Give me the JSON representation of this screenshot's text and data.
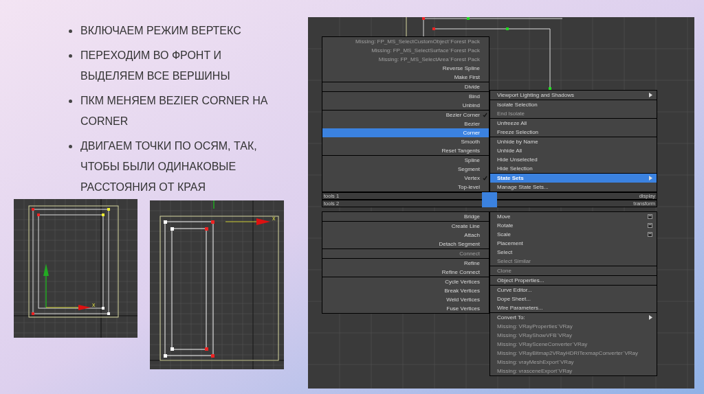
{
  "bullets": [
    "ВКЛЮЧАЕМ РЕЖИМ ВЕРТЕКС",
    "ПЕРЕХОДИМ ВО ФРОНТ И ВЫДЕЛЯЕМ ВСЕ ВЕРШИНЫ",
    "ПКМ МЕНЯЕМ BEZIER CORNER НА CORNER",
    "ДВИГАЕМ ТОЧКИ ПО ОСЯМ, ТАК, ЧТОБЫ БЫЛИ ОДИНАКОВЫЕ РАССТОЯНИЯ ОТ КРАЯ"
  ],
  "viewports": [
    {
      "axis_label": "x"
    },
    {
      "axis_label": "x"
    }
  ],
  "quad_menu": {
    "top_left": [
      [
        {
          "label": "Missing: FP_MS_SelectCustomObject`Forest Pack",
          "disabled": true,
          "checked": false,
          "selected": false
        },
        {
          "label": "Missing: FP_MS_SelectSurface`Forest Pack",
          "disabled": true,
          "checked": false,
          "selected": false
        },
        {
          "label": "Missing: FP_MS_SelectArea`Forest Pack",
          "disabled": true,
          "checked": false,
          "selected": false
        },
        {
          "label": "Reverse Spline",
          "disabled": false,
          "checked": false,
          "selected": false
        },
        {
          "label": "Make First",
          "disabled": false,
          "checked": false,
          "selected": false
        }
      ],
      [
        {
          "label": "Divide",
          "disabled": false,
          "checked": false,
          "selected": false
        }
      ],
      [
        {
          "label": "Bind",
          "disabled": false,
          "checked": false,
          "selected": false
        },
        {
          "label": "Unbind",
          "disabled": false,
          "checked": false,
          "selected": false
        }
      ],
      [
        {
          "label": "Bezier Corner",
          "disabled": false,
          "checked": true,
          "selected": false
        },
        {
          "label": "Bezier",
          "disabled": false,
          "checked": false,
          "selected": false
        },
        {
          "label": "Corner",
          "disabled": false,
          "checked": false,
          "selected": true
        },
        {
          "label": "Smooth",
          "disabled": false,
          "checked": false,
          "selected": false
        },
        {
          "label": "Reset Tangents",
          "disabled": false,
          "checked": false,
          "selected": false
        }
      ],
      [
        {
          "label": "Spline",
          "disabled": false,
          "checked": false,
          "selected": false
        },
        {
          "label": "Segment",
          "disabled": false,
          "checked": false,
          "selected": false
        },
        {
          "label": "Vertex",
          "disabled": false,
          "checked": true,
          "selected": false
        },
        {
          "label": "Top-level",
          "disabled": false,
          "checked": false,
          "selected": false
        }
      ]
    ],
    "top_right": [
      [
        {
          "label": "Viewport Lighting and Shadows",
          "kind": "submenu",
          "disabled": false,
          "selected": false
        }
      ],
      [
        {
          "label": "Isolate Selection",
          "kind": "plain",
          "disabled": false,
          "selected": false
        },
        {
          "label": "End Isolate",
          "kind": "plain",
          "disabled": true,
          "selected": false
        }
      ],
      [
        {
          "label": "Unfreeze All",
          "kind": "plain",
          "disabled": false,
          "selected": false
        },
        {
          "label": "Freeze Selection",
          "kind": "plain",
          "disabled": false,
          "selected": false
        }
      ],
      [
        {
          "label": "Unhide by Name",
          "kind": "plain",
          "disabled": false,
          "selected": false
        },
        {
          "label": "Unhide All",
          "kind": "plain",
          "disabled": false,
          "selected": false
        },
        {
          "label": "Hide Unselected",
          "kind": "plain",
          "disabled": false,
          "selected": false
        },
        {
          "label": "Hide Selection",
          "kind": "plain",
          "disabled": false,
          "selected": false
        }
      ],
      [
        {
          "label": "State Sets",
          "kind": "submenu",
          "disabled": false,
          "selected": true
        },
        {
          "label": "Manage State Sets...",
          "kind": "plain",
          "disabled": false,
          "selected": false
        }
      ]
    ],
    "headers": [
      {
        "left": "tools 1",
        "right": "display"
      },
      {
        "left": "tools 2",
        "right": "transform"
      }
    ],
    "bottom_left": [
      [
        {
          "label": "Bridge",
          "disabled": false,
          "checked": false,
          "selected": false
        }
      ],
      [
        {
          "label": "Create Line",
          "disabled": false,
          "checked": false,
          "selected": false
        },
        {
          "label": "Attach",
          "disabled": false,
          "checked": false,
          "selected": false
        },
        {
          "label": "Detach Segment",
          "disabled": false,
          "checked": false,
          "selected": false
        }
      ],
      [
        {
          "label": "Connect",
          "disabled": true,
          "checked": false,
          "selected": false
        }
      ],
      [
        {
          "label": "Refine",
          "disabled": false,
          "checked": false,
          "selected": false
        },
        {
          "label": "Refine Connect",
          "disabled": false,
          "checked": false,
          "selected": false
        }
      ],
      [
        {
          "label": "Cycle Vertices",
          "disabled": false,
          "checked": false,
          "selected": false
        },
        {
          "label": "Break Vertices",
          "disabled": false,
          "checked": false,
          "selected": false
        },
        {
          "label": "Weld Vertices",
          "disabled": false,
          "checked": false,
          "selected": false
        },
        {
          "label": "Fuse Vertices",
          "disabled": false,
          "checked": false,
          "selected": false
        }
      ]
    ],
    "bottom_right": [
      [
        {
          "label": "Move",
          "kind": "options",
          "disabled": false,
          "selected": false
        },
        {
          "label": "Rotate",
          "kind": "options",
          "disabled": false,
          "selected": false
        },
        {
          "label": "Scale",
          "kind": "options",
          "disabled": false,
          "selected": false
        },
        {
          "label": "Placement",
          "kind": "plain",
          "disabled": false,
          "selected": false
        },
        {
          "label": "Select",
          "kind": "plain",
          "disabled": false,
          "selected": false
        },
        {
          "label": "Select Similar",
          "kind": "plain",
          "disabled": true,
          "selected": false
        }
      ],
      [
        {
          "label": "Clone",
          "kind": "plain",
          "disabled": true,
          "selected": false
        }
      ],
      [
        {
          "label": "Object Properties...",
          "kind": "plain",
          "disabled": false,
          "selected": false
        }
      ],
      [
        {
          "label": "Curve Editor...",
          "kind": "plain",
          "disabled": false,
          "selected": false
        },
        {
          "label": "Dope Sheet...",
          "kind": "plain",
          "disabled": false,
          "selected": false
        },
        {
          "label": "Wire Parameters...",
          "kind": "plain",
          "disabled": false,
          "selected": false
        }
      ],
      [
        {
          "label": "Convert To:",
          "kind": "submenu",
          "disabled": false,
          "selected": false
        },
        {
          "label": "Missing: VRayProperties`VRay",
          "kind": "plain",
          "disabled": true,
          "selected": false
        },
        {
          "label": "Missing: VRayShowVFB`VRay",
          "kind": "plain",
          "disabled": true,
          "selected": false
        },
        {
          "label": "Missing: VRaySceneConverter`VRay",
          "kind": "plain",
          "disabled": true,
          "selected": false
        },
        {
          "label": "Missing: VRayBitmap2VRayHDRITexmapConverter`VRay",
          "kind": "plain",
          "disabled": true,
          "selected": false
        },
        {
          "label": "Missing: vrayMeshExport`VRay",
          "kind": "plain",
          "disabled": true,
          "selected": false
        },
        {
          "label": "Missing: vrasceneExport`VRay",
          "kind": "plain",
          "disabled": true,
          "selected": false
        }
      ]
    ]
  }
}
